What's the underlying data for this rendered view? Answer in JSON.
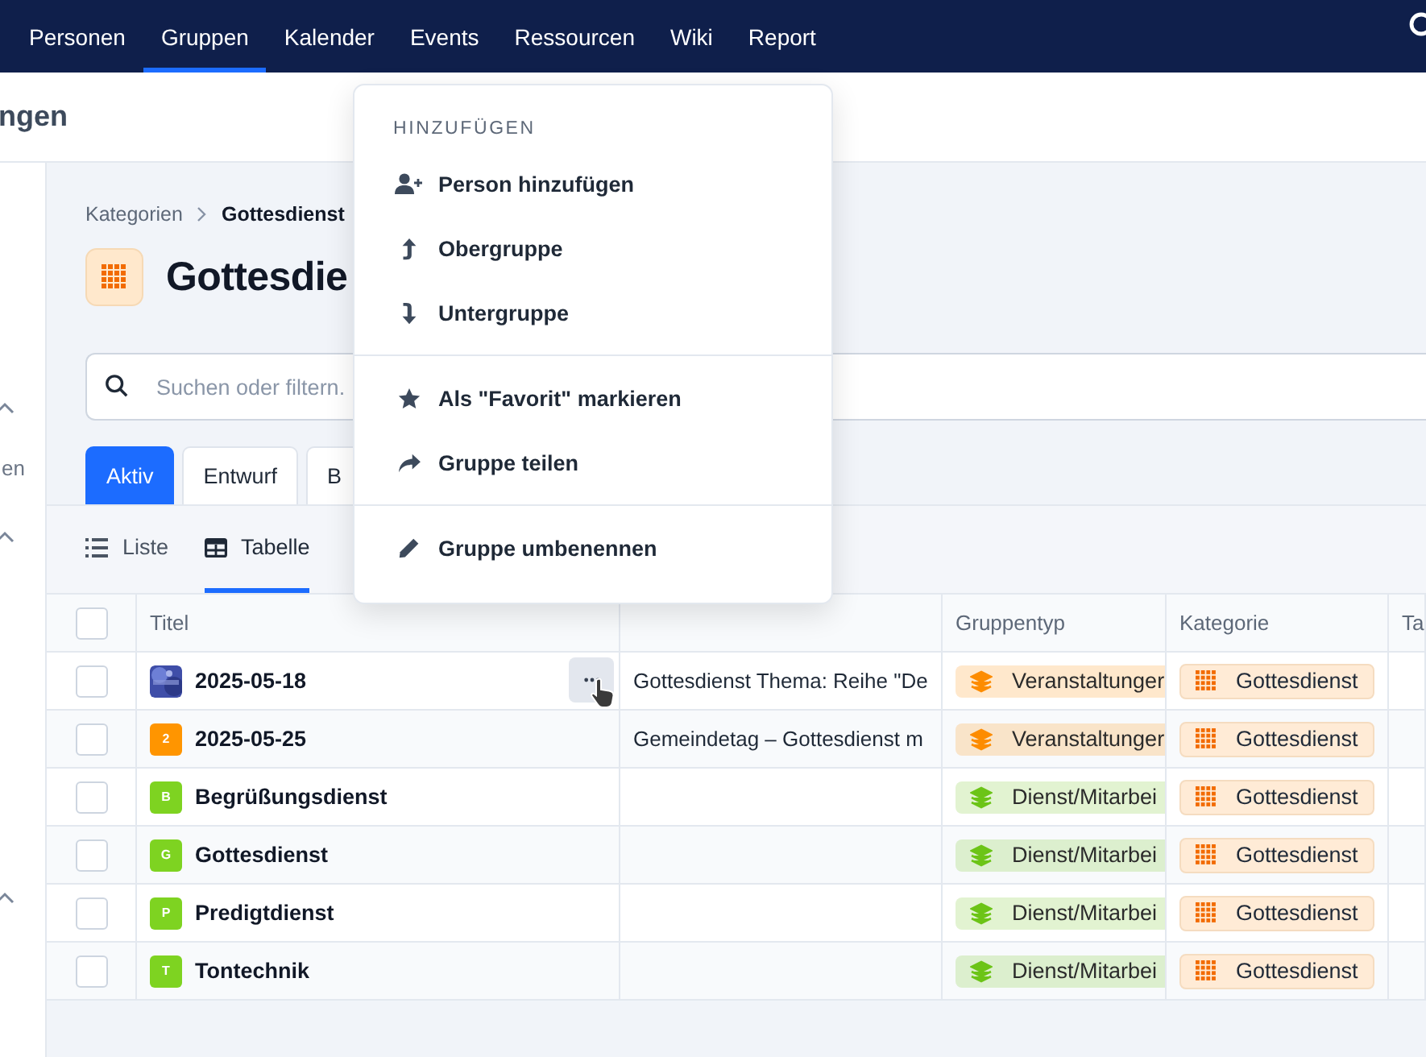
{
  "nav": {
    "items": [
      {
        "label": "Personen",
        "selected": false
      },
      {
        "label": "Gruppen",
        "selected": true
      },
      {
        "label": "Kalender",
        "selected": false
      },
      {
        "label": "Events",
        "selected": false
      },
      {
        "label": "Ressourcen",
        "selected": false
      },
      {
        "label": "Wiki",
        "selected": false
      },
      {
        "label": "Report",
        "selected": false
      }
    ]
  },
  "subheader": {
    "title": "ngen"
  },
  "sidebar": {
    "label": "en"
  },
  "breadcrumb": [
    "Kategorien",
    "Gottesdienst"
  ],
  "page_title": "Gottesdie",
  "search": {
    "placeholder": "Suchen oder filtern."
  },
  "status_tabs": [
    {
      "label": "Aktiv",
      "selected": true
    },
    {
      "label": "Entwurf",
      "selected": false
    },
    {
      "label": "B",
      "selected": false
    }
  ],
  "view_tabs": [
    {
      "label": "Liste",
      "kind": "list",
      "selected": false
    },
    {
      "label": "Tabelle",
      "kind": "table",
      "selected": true
    }
  ],
  "table": {
    "all_checked": false,
    "columns": [
      "Titel",
      "Gruppentyp",
      "Kategorie",
      "Ta"
    ],
    "rows": [
      {
        "checked": false,
        "title": "2025-05-18",
        "hovered": true,
        "description": "Gottesdienst Thema: Reihe \"De",
        "type": {
          "label": "Veranstaltunger",
          "color": "#fd8c00"
        },
        "category": "Gottesdienst"
      },
      {
        "checked": false,
        "avatar": {
          "kind": "letter",
          "letter": "2",
          "color": "#ff9500"
        },
        "title": "2025-05-25",
        "hovered": false,
        "description": "Gemeindetag – Gottesdienst m",
        "type": {
          "label": "Veranstaltunger",
          "color": "#fd8c00"
        },
        "category": "Gottesdienst"
      },
      {
        "checked": false,
        "avatar": {
          "kind": "letter",
          "letter": "B",
          "color": "#7ed321"
        },
        "title": "Begrüßungsdienst",
        "hovered": false,
        "type": {
          "label": "Dienst/Mitarbei",
          "color": "#6cc417"
        },
        "category": "Gottesdienst"
      },
      {
        "checked": false,
        "avatar": {
          "kind": "letter",
          "letter": "G",
          "color": "#7ed321"
        },
        "title": "Gottesdienst",
        "hovered": false,
        "type": {
          "label": "Dienst/Mitarbei",
          "color": "#6cc417"
        },
        "category": "Gottesdienst"
      },
      {
        "checked": false,
        "avatar": {
          "kind": "letter",
          "letter": "P",
          "color": "#7ed321"
        },
        "title": "Predigtdienst",
        "hovered": false,
        "type": {
          "label": "Dienst/Mitarbei",
          "color": "#6cc417"
        },
        "category": "Gottesdienst"
      },
      {
        "checked": false,
        "avatar": {
          "kind": "letter",
          "letter": "T",
          "color": "#7ed321"
        },
        "title": "Tontechnik",
        "hovered": false,
        "type": {
          "label": "Dienst/Mitarbei",
          "color": "#6cc417"
        },
        "category": "Gottesdienst"
      }
    ]
  },
  "menu": {
    "sections": [
      {
        "heading": "HINZUFÜGEN",
        "items": [
          {
            "label": "Person hinzufügen",
            "kind": "add-person"
          },
          {
            "label": "Obergruppe",
            "kind": "up"
          },
          {
            "label": "Untergruppe",
            "kind": "down"
          }
        ]
      },
      {
        "items": [
          {
            "label": "Als \"Favorit\" markieren",
            "kind": "star"
          },
          {
            "label": "Gruppe teilen",
            "kind": "share"
          }
        ]
      },
      {
        "items": [
          {
            "label": "Gruppe umbenennen",
            "kind": "rename"
          }
        ]
      }
    ]
  }
}
